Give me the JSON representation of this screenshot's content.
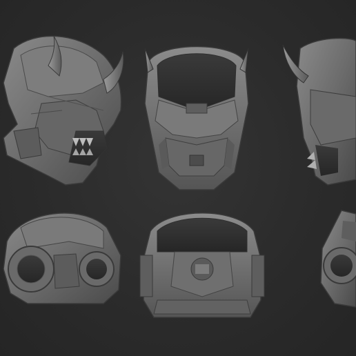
{
  "scene": {
    "background_color": "#2a2a2a",
    "material_color": "#6e6e6e",
    "views": [
      {
        "id": "oni-mask-side-left",
        "icon": "oni-helmet-side-icon"
      },
      {
        "id": "oni-mask-front",
        "icon": "oni-helmet-front-icon"
      },
      {
        "id": "oni-mask-side-right",
        "icon": "oni-helmet-side-icon"
      },
      {
        "id": "helmet-shell-side-left",
        "icon": "helmet-shell-side-icon"
      },
      {
        "id": "helmet-shell-back",
        "icon": "helmet-shell-back-icon"
      },
      {
        "id": "helmet-shell-side-right",
        "icon": "helmet-shell-side-icon"
      }
    ]
  }
}
